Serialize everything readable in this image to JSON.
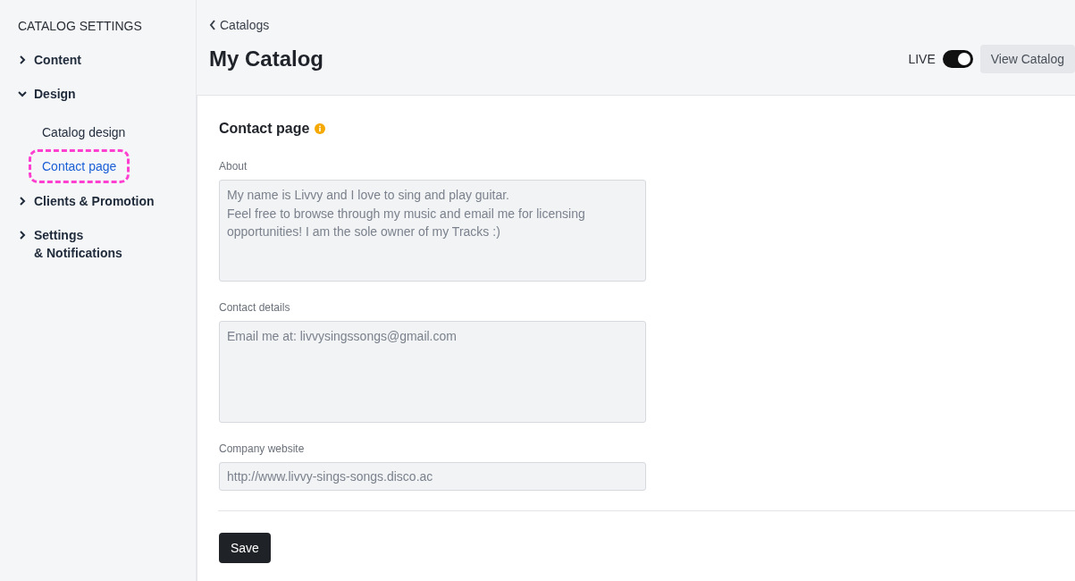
{
  "sidebar": {
    "title": "CATALOG SETTINGS",
    "items": [
      {
        "label": "Content",
        "expanded": false
      },
      {
        "label": "Design",
        "expanded": true,
        "children": [
          {
            "label": "Catalog design",
            "selected": false
          },
          {
            "label": "Contact page",
            "selected": true
          }
        ]
      },
      {
        "label": "Clients & Promotion",
        "expanded": false
      },
      {
        "label": "Settings\n& Notifications",
        "expanded": false
      }
    ]
  },
  "header": {
    "back_link": "Catalogs",
    "title": "My Catalog",
    "live": {
      "label": "LIVE",
      "on": true
    },
    "view_button": "View Catalog"
  },
  "form": {
    "title": "Contact page",
    "fields": [
      {
        "label": "About",
        "kind": "textarea",
        "value": "My name is Livvy and I love to sing and play guitar.\nFeel free to browse through my music and email me for licensing opportunities! I am the sole owner of my Tracks :)"
      },
      {
        "label": "Contact details",
        "kind": "textarea",
        "value": "Email me at: livvysingssongs@gmail.com"
      },
      {
        "label": "Company website",
        "kind": "input",
        "value": "http://www.livvy-sings-songs.disco.ac"
      }
    ],
    "save_button": "Save"
  }
}
